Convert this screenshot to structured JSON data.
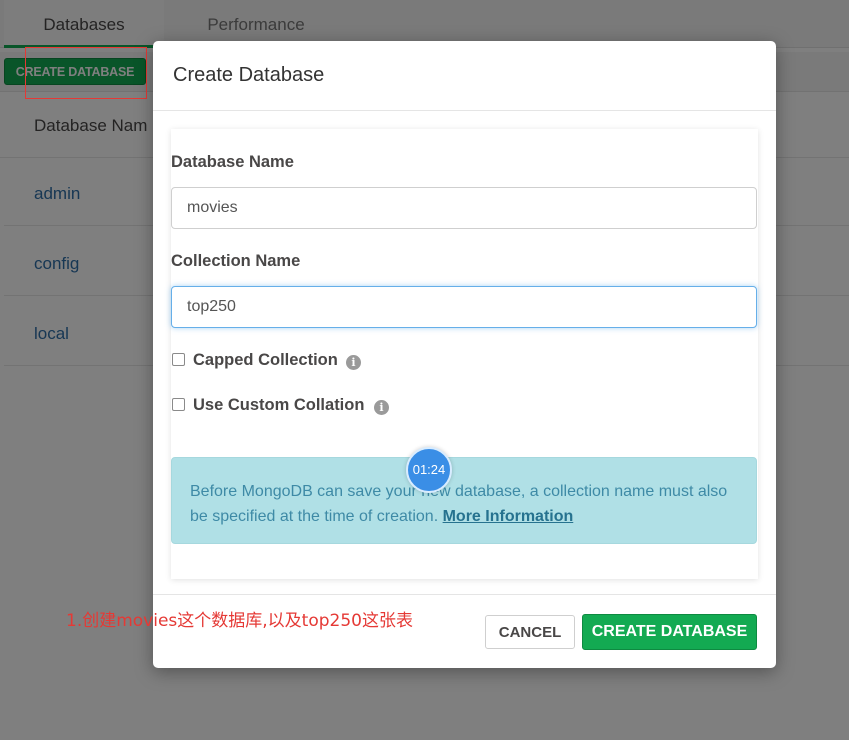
{
  "tabs": [
    {
      "label": "Databases"
    },
    {
      "label": "Performance"
    }
  ],
  "toolbar": {
    "create_database_label": "CREATE DATABASE"
  },
  "table": {
    "header_name": "Database Nam",
    "rows": [
      {
        "name": "admin"
      },
      {
        "name": "config"
      },
      {
        "name": "local"
      }
    ]
  },
  "modal": {
    "title": "Create Database",
    "database_name_label": "Database Name",
    "database_name_value": "movies",
    "collection_name_label": "Collection Name",
    "collection_name_value": "top250",
    "capped_collection_label": "Capped Collection",
    "custom_collation_label": "Use Custom Collation",
    "info_icon_glyph": "i",
    "alert_text": "Before MongoDB can save your new database, a collection name must also be specified at the time of creation.",
    "alert_link": "More Information",
    "cancel_label": "CANCEL",
    "create_label": "CREATE DATABASE"
  },
  "timer": {
    "text": "01:24"
  },
  "annotation": {
    "text": "1.创建movies这个数据库,以及top250这张表"
  },
  "colors": {
    "accent_green": "#13aa52",
    "link_blue": "#2f6fa8",
    "alert_bg": "#b0e0e6",
    "annotation_red": "#e53935"
  }
}
